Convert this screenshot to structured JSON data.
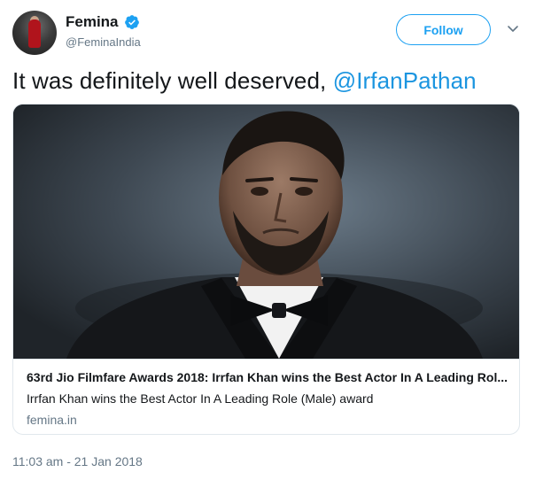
{
  "author": {
    "name": "Femina",
    "handle": "@FeminaIndia",
    "verified": true,
    "avatar_icon": "avatar-icon"
  },
  "actions": {
    "follow_label": "Follow",
    "more_icon": "chevron-down-icon"
  },
  "tweet": {
    "text": "It was definitely well deserved, ",
    "mention": "@IrfanPathan"
  },
  "card": {
    "title": "63rd Jio Filmfare Awards 2018: Irrfan Khan wins the Best Actor In A Leading Rol...",
    "description": "Irrfan Khan wins the Best Actor In A Leading Role (Male) award",
    "domain": "femina.in"
  },
  "timestamp": "11:03 am - 21 Jan 2018",
  "colors": {
    "accent": "#1da1f2",
    "link": "#1b95e0",
    "muted": "#657786",
    "border": "#e1e8ed",
    "text": "#14171a"
  }
}
